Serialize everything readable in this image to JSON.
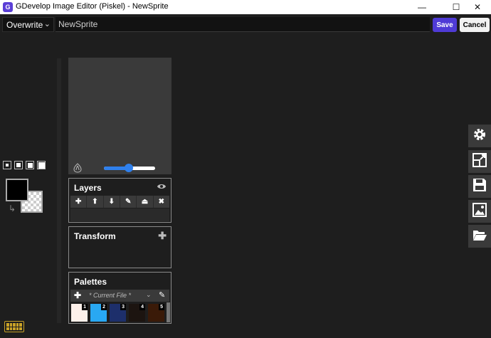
{
  "window": {
    "title": "GDevelop Image Editor (Piskel) - NewSprite",
    "logo_letter": "G",
    "minimize": "—",
    "maximize": "☐",
    "close": "✕"
  },
  "toolbar": {
    "mode_value": "Overwrite",
    "mode_arrow": "⌄",
    "sprite_name": "NewSprite",
    "save_label": "Save",
    "cancel_label": "Cancel"
  },
  "preview": {
    "fps_level": 0.45
  },
  "layers": {
    "title": "Layers",
    "eye_icon": "visibility-icon",
    "tools": [
      "✚",
      "⬆",
      "⬇",
      "✎",
      "⏏",
      "✖"
    ]
  },
  "transform": {
    "title": "Transform",
    "add_icon": "✚"
  },
  "palettes": {
    "title": "Palettes",
    "add_icon": "✚",
    "selected": "* Current File *",
    "dropdown_arrow": "⌄",
    "edit_icon": "✎",
    "swatches": [
      {
        "number": "1",
        "color": "#fdf0ea"
      },
      {
        "number": "2",
        "color": "#29a8f2"
      },
      {
        "number": "3",
        "color": "#1d2f6b"
      },
      {
        "number": "4",
        "color": "#1c1410"
      },
      {
        "number": "5",
        "color": "#3a1a08"
      }
    ]
  },
  "colors": {
    "primary": "#000000",
    "accent": "#4f3bd6"
  },
  "side_tools": [
    "gear-icon",
    "resize-icon",
    "save-icon",
    "image-icon",
    "folder-open-icon"
  ]
}
